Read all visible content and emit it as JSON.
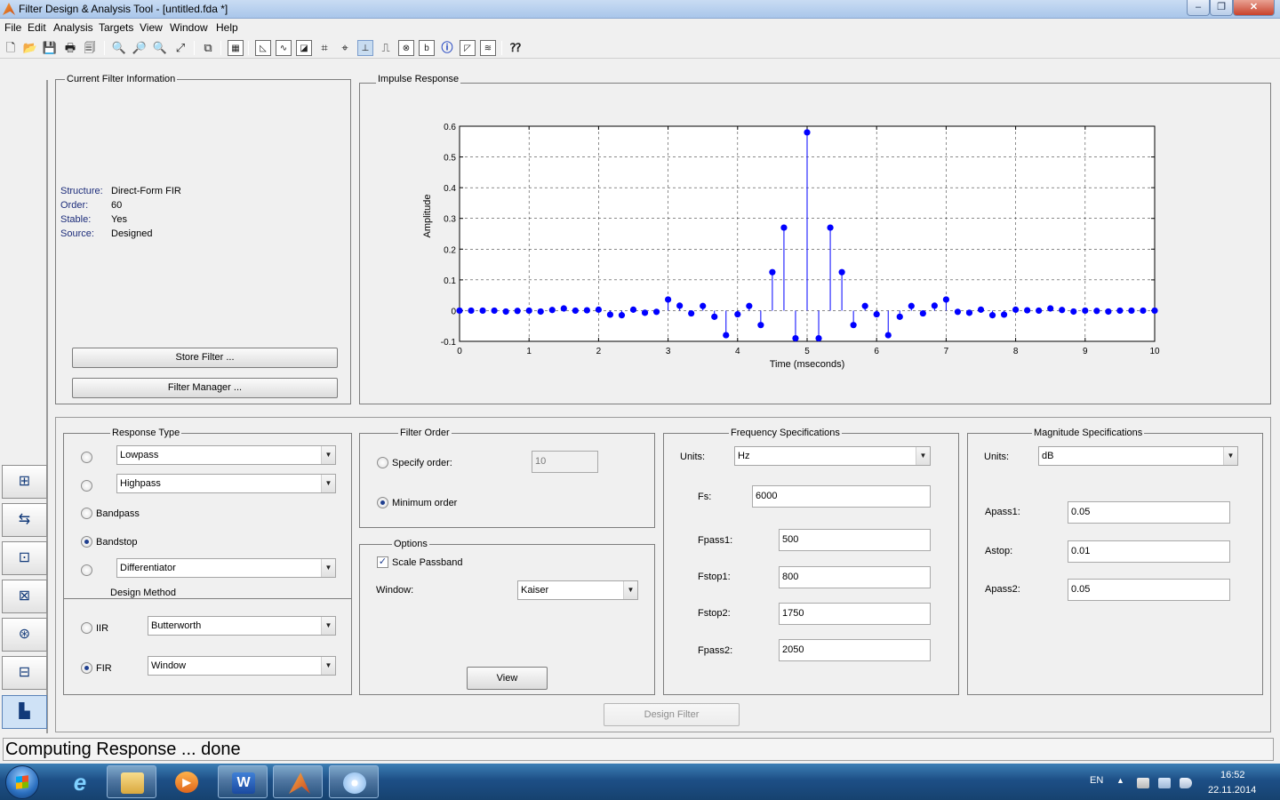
{
  "window": {
    "title": "Filter Design & Analysis Tool -  [untitled.fda *]",
    "minimize_icon": "minimize-icon",
    "maximize_icon": "maximize-icon",
    "close_icon": "close-icon",
    "min_glyph": "–",
    "max_glyph": "❐",
    "close_glyph": "✕"
  },
  "menu": [
    "File",
    "Edit",
    "Analysis",
    "Targets",
    "View",
    "Window",
    "Help"
  ],
  "toolbar": {
    "icons": [
      "new-icon",
      "open-icon",
      "save-icon",
      "print-icon",
      "print-preview-icon",
      "zoom-in-icon",
      "zoom-x-icon",
      "zoom-y-icon",
      "full-view-icon",
      "new-figure-icon",
      "filter-specs-icon",
      "magnitude-response-icon",
      "phase-response-icon",
      "magnitude-phase-icon",
      "group-delay-icon",
      "phase-delay-icon",
      "impulse-response-icon",
      "step-response-icon",
      "pole-zero-icon",
      "filter-coefficients-icon",
      "filter-info-icon",
      "magnitude-estimate-icon",
      "noise-power-icon",
      "whats-this-icon"
    ]
  },
  "current_filter": {
    "group_title": "Current Filter Information",
    "rows": [
      {
        "label": "Structure:",
        "value": "Direct-Form FIR"
      },
      {
        "label": "Order:",
        "value": "60"
      },
      {
        "label": "Stable:",
        "value": "Yes"
      },
      {
        "label": "Source:",
        "value": "Designed"
      }
    ],
    "store_button": "Store Filter ...",
    "manager_button": "Filter Manager ..."
  },
  "impulse_panel": {
    "group_title": "Impulse Response"
  },
  "chart_data": {
    "type": "stem",
    "title": "",
    "xlabel": "Time (mseconds)",
    "ylabel": "Amplitude",
    "xlim": [
      0,
      10
    ],
    "ylim": [
      -0.1,
      0.6
    ],
    "xticks": [
      0,
      1,
      2,
      3,
      4,
      5,
      6,
      7,
      8,
      9,
      10
    ],
    "yticks": [
      -0.1,
      0,
      0.1,
      0.2,
      0.3,
      0.4,
      0.5,
      0.6
    ],
    "grid": true,
    "marker_color": "#0000ff",
    "series": [
      {
        "x": [
          0.0,
          0.1667,
          0.3333,
          0.5,
          0.6667,
          0.8333,
          1.0,
          1.1667,
          1.3333,
          1.5,
          1.6667,
          1.8333,
          2.0,
          2.1667,
          2.3333,
          2.5,
          2.6667,
          2.8333,
          3.0,
          3.1667,
          3.3333,
          3.5,
          3.6667,
          3.8333,
          4.0,
          4.1667,
          4.3333,
          4.5,
          4.6667,
          4.8333,
          5.0,
          5.1667,
          5.3333,
          5.5,
          5.6667,
          5.8333,
          6.0,
          6.1667,
          6.3333,
          6.5,
          6.6667,
          6.8333,
          7.0,
          7.1667,
          7.3333,
          7.5,
          7.6667,
          7.8333,
          8.0,
          8.1667,
          8.3333,
          8.5,
          8.6667,
          8.8333,
          9.0,
          9.1667,
          9.3333,
          9.5,
          9.6667,
          9.8333,
          10.0
        ],
        "y": [
          0.0,
          0.0,
          0.0,
          0.0,
          -0.003,
          -0.001,
          0.0,
          -0.003,
          0.002,
          0.007,
          0.0,
          0.001,
          0.003,
          -0.013,
          -0.015,
          0.003,
          -0.007,
          -0.004,
          0.036,
          0.016,
          -0.009,
          0.015,
          -0.02,
          -0.08,
          -0.012,
          0.015,
          -0.047,
          0.125,
          0.27,
          -0.09,
          0.58,
          -0.09,
          0.27,
          0.125,
          -0.047,
          0.015,
          -0.012,
          -0.08,
          -0.02,
          0.015,
          -0.009,
          0.016,
          0.036,
          -0.004,
          -0.007,
          0.003,
          -0.015,
          -0.013,
          0.003,
          0.001,
          0.0,
          0.007,
          0.002,
          -0.003,
          0.0,
          -0.001,
          -0.003,
          0.0,
          0.0,
          0.0,
          0.0
        ]
      }
    ]
  },
  "response_type": {
    "group_title": "Response Type",
    "lowpass": "Lowpass",
    "highpass": "Highpass",
    "bandpass": "Bandpass",
    "bandstop": "Bandstop",
    "differentiator": "Differentiator",
    "selected": "Bandstop"
  },
  "design_method": {
    "group_title": "Design Method",
    "iir_label": "IIR",
    "iir_value": "Butterworth",
    "fir_label": "FIR",
    "fir_value": "Window",
    "selected": "FIR"
  },
  "filter_order": {
    "group_title": "Filter Order",
    "specify_label": "Specify order:",
    "specify_value": "10",
    "minimum_label": "Minimum order",
    "selected": "Minimum order"
  },
  "options": {
    "group_title": "Options",
    "scale_passband_label": "Scale Passband",
    "scale_passband_checked": true,
    "window_label": "Window:",
    "window_value": "Kaiser",
    "view_button": "View"
  },
  "frequency": {
    "group_title": "Frequency Specifications",
    "units_label": "Units:",
    "units_value": "Hz",
    "fs_label": "Fs:",
    "fs_value": "6000",
    "fpass1_label": "Fpass1:",
    "fpass1_value": "500",
    "fstop1_label": "Fstop1:",
    "fstop1_value": "800",
    "fstop2_label": "Fstop2:",
    "fstop2_value": "1750",
    "fpass2_label": "Fpass2:",
    "fpass2_value": "2050"
  },
  "magnitude": {
    "group_title": "Magnitude Specifications",
    "units_label": "Units:",
    "units_value": "dB",
    "apass1_label": "Apass1:",
    "apass1_value": "0.05",
    "astop_label": "Astop:",
    "astop_value": "0.01",
    "apass2_label": "Apass2:",
    "apass2_value": "0.05"
  },
  "design_button": "Design Filter",
  "status": "Computing Response ... done",
  "sidebar_icons": [
    "transform-filter-icon",
    "create-multirate-icon",
    "realize-model-icon",
    "pole-zero-editor-icon",
    "quantize-icon",
    "import-filter-icon",
    "design-filter-icon"
  ],
  "taskbar": {
    "apps": [
      "internet-explorer-icon",
      "file-explorer-icon",
      "media-player-icon",
      "word-icon",
      "matlab-icon",
      "paint-icon"
    ],
    "word_glyph": "W",
    "ie_glyph": "e",
    "language": "EN",
    "time": "16:52",
    "date": "22.11.2014"
  }
}
